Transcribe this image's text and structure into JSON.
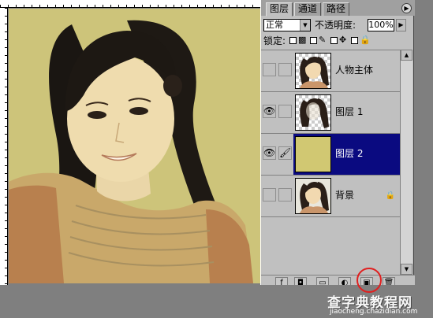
{
  "palette": {
    "tabs": [
      "图层",
      "通道",
      "路径"
    ],
    "menu_glyph": "▶",
    "blend_mode": "正常",
    "opacity_label": "不透明度:",
    "opacity_value": "100%",
    "lock_label": "锁定:",
    "layers": [
      {
        "name": "人物主体",
        "visible": false,
        "selected": false,
        "thumb": "person-transparent"
      },
      {
        "name": "图层 1",
        "visible": true,
        "selected": false,
        "thumb": "hair-transparent"
      },
      {
        "name": "图层 2",
        "visible": true,
        "selected": true,
        "thumb": "solid-fill",
        "fill_color": "#d1c872"
      },
      {
        "name": "背景",
        "visible": false,
        "selected": false,
        "thumb": "photo",
        "locked": true
      }
    ]
  },
  "canvas": {
    "tint_color": "#cdc47a"
  },
  "watermark": {
    "title_a": "查字典",
    "title_b": "教程网",
    "subtitle": "jiaocheng.chazidian.com"
  },
  "colors": {
    "selection": "#0a0a80",
    "highlight_ring": "#e02020",
    "panel": "#c0c0c0"
  }
}
